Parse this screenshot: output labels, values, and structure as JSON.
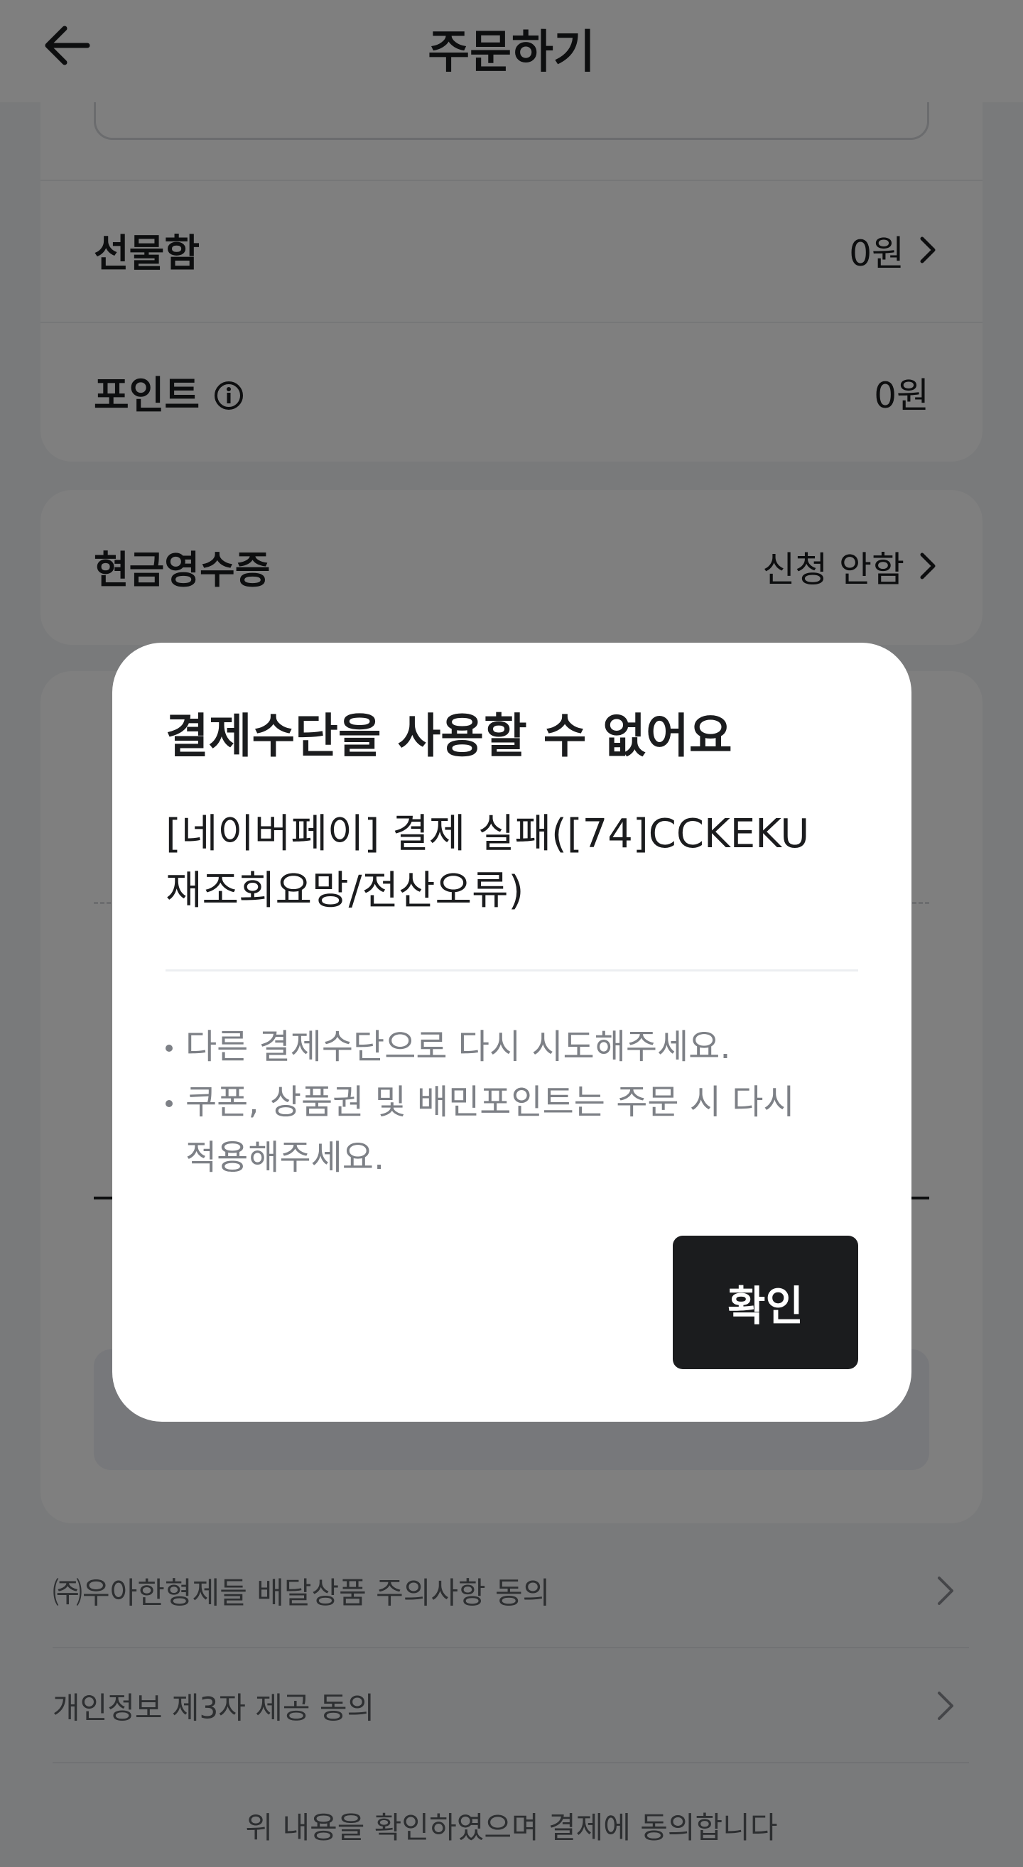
{
  "header": {
    "title": "주문하기",
    "back_icon": "arrow-left-icon"
  },
  "payment_rows": [
    {
      "label": "선물함",
      "value": "0원"
    },
    {
      "label": "포인트",
      "value": "0원"
    }
  ],
  "cash_receipt": {
    "label": "현금영수증",
    "value": "신청 안함"
  },
  "agreements": [
    {
      "label": "㈜우아한형제들 배달상품 주의사항 동의"
    },
    {
      "label": "개인정보 제3자 제공 동의"
    }
  ],
  "consent_text": "위 내용을 확인하였으며 결제에 동의합니다",
  "dialog": {
    "title": "결제수단을 사용할 수 없어요",
    "message_line1": "[네이버페이] 결제 실패([74]CCKEKU",
    "message_line2": "재조회요망/전산오류)",
    "notes": [
      "다른 결제수단으로 다시 시도해주세요.",
      "쿠폰, 상품권 및 배민포인트는 주문 시 다시",
      "적용해주세요."
    ],
    "confirm_label": "확인"
  },
  "colors": {
    "accent_blue": "#2d3bd6",
    "dark": "#1b1c1e",
    "overlay": "rgba(0,0,0,0.5)"
  }
}
